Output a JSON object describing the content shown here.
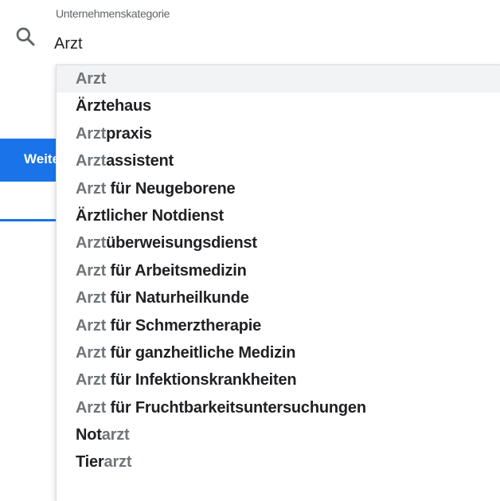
{
  "field": {
    "label": "Unternehmenskategorie",
    "value": "Arzt"
  },
  "next_button": {
    "label": "Weiter"
  },
  "suggestions": [
    {
      "match": "Arzt",
      "rest": "",
      "highlighted": true
    },
    {
      "match": "",
      "rest": "Ärztehaus"
    },
    {
      "match": "Arzt",
      "rest": "praxis"
    },
    {
      "match": "Arzt",
      "rest": "assistent"
    },
    {
      "match": "Arzt",
      "rest": " für Neugeborene"
    },
    {
      "match": "",
      "rest": "Ärztlicher Notdienst"
    },
    {
      "match": "Arzt",
      "rest": "überweisungsdienst"
    },
    {
      "match": "Arzt",
      "rest": " für Arbeitsmedizin"
    },
    {
      "match": "Arzt",
      "rest": " für Naturheilkunde"
    },
    {
      "match": "Arzt",
      "rest": " für Schmerztherapie"
    },
    {
      "match": "Arzt",
      "rest": " für ganzheitliche Medizin"
    },
    {
      "match": "Arzt",
      "rest": " für Infektionskrankheiten"
    },
    {
      "match": "Arzt",
      "rest": " für Fruchtbarkeitsuntersuchungen"
    },
    {
      "match": "",
      "rest": "Not",
      "trail": "arzt"
    },
    {
      "match": "",
      "rest": "Tier",
      "trail": "arzt"
    }
  ],
  "colors": {
    "accent": "#1a73e8",
    "match_text": "#70757a",
    "text": "#202124",
    "highlight_bg": "#f1f3f4"
  }
}
